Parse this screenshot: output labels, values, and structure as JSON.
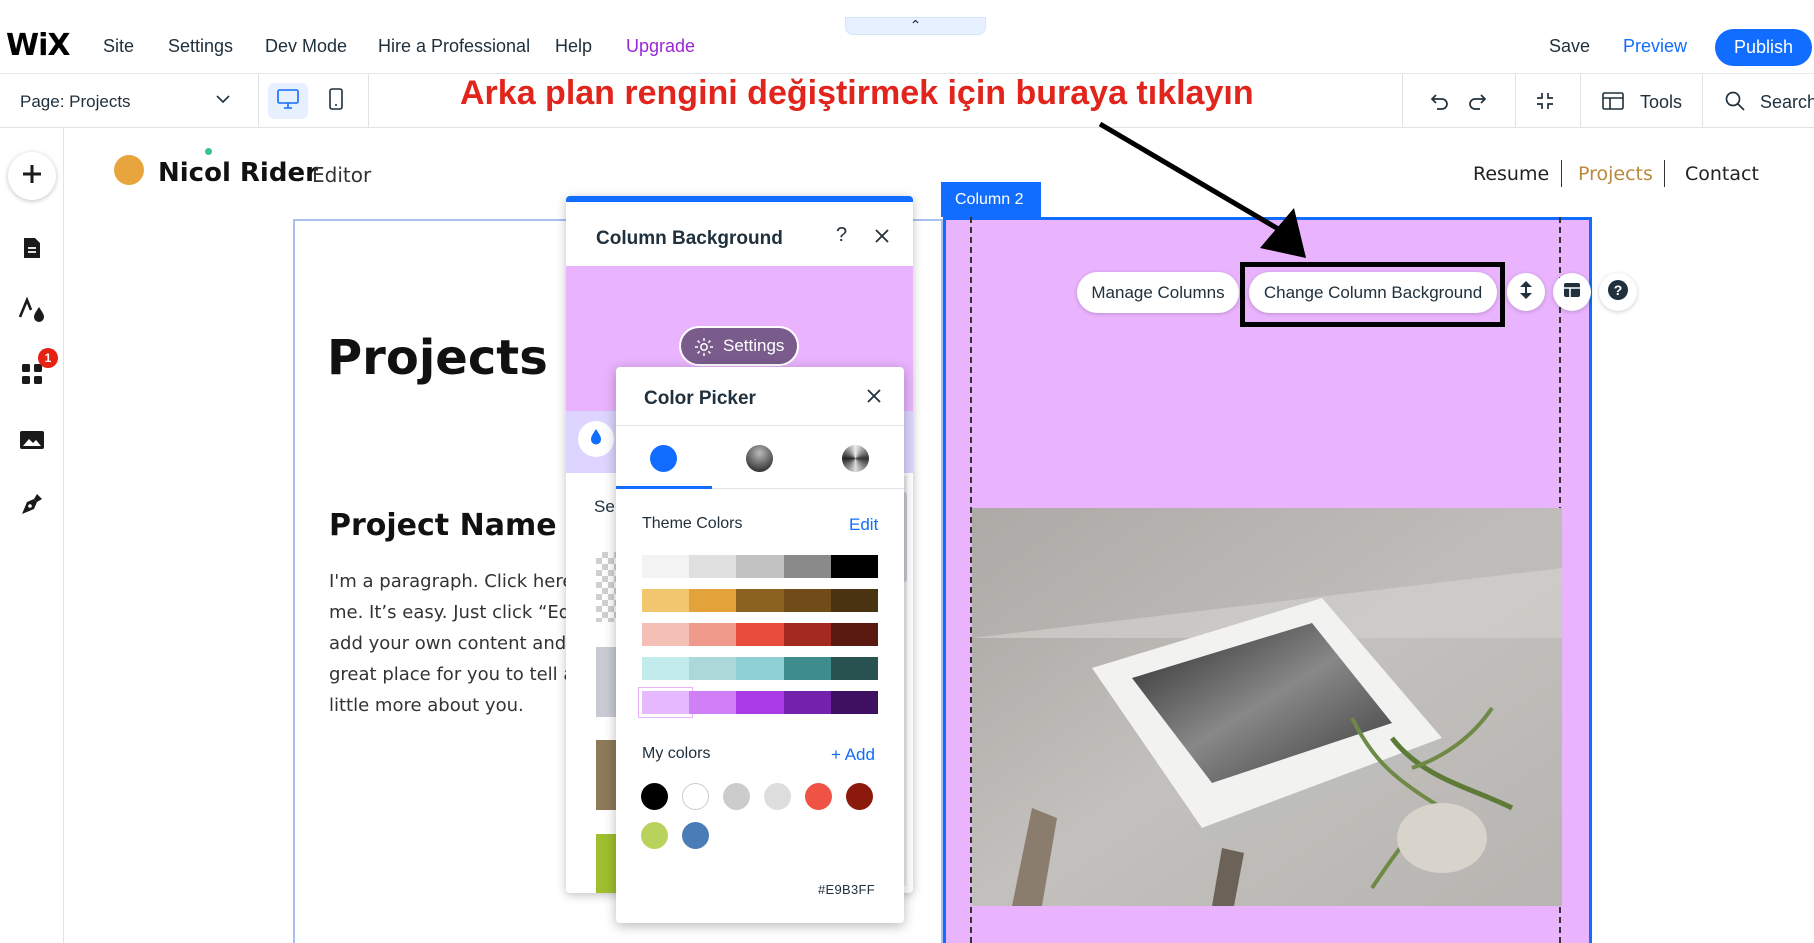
{
  "topbar": {
    "logo": "WiX",
    "menu": [
      "Site",
      "Settings",
      "Dev Mode",
      "Hire a Professional",
      "Help",
      "Upgrade"
    ],
    "handle_glyph": "⌃",
    "save": "Save",
    "preview": "Preview",
    "publish": "Publish"
  },
  "secondbar": {
    "page_select": "Page: Projects",
    "tools": "Tools",
    "search": "Search",
    "annotation": "Arka plan rengini değiştirmek için buraya tıklayın"
  },
  "leftbar": {
    "icons": [
      "add-icon",
      "pages-icon",
      "design-icon",
      "apps-icon",
      "media-icon",
      "pen-icon"
    ],
    "apps_badge": "1"
  },
  "site": {
    "name": "Nicol Rider",
    "role": "Editor",
    "nav": [
      "Resume",
      "Projects",
      "Contact"
    ],
    "heading": "Projects",
    "project_name": "Project Name 0",
    "paragraph": "I'm a paragraph. Click here t\nme. It’s easy. Just click “Edit\nadd your own content and m\ngreat place for you to tell a s\nlittle more about you."
  },
  "column2": {
    "label": "Column 2",
    "manage_columns": "Manage Columns",
    "change_background": "Change Column Background",
    "color": "#E9B3FF"
  },
  "panel": {
    "title": "Column Background",
    "help": "?",
    "settings": "Settings",
    "section_label_partial": "Se"
  },
  "picker": {
    "title": "Color Picker",
    "theme_colors_label": "Theme Colors",
    "edit": "Edit",
    "theme_rows": [
      [
        "#f3f3f3",
        "#e0e0e0",
        "#c2c2c2",
        "#8a8a8a",
        "#000000"
      ],
      [
        "#f2c66e",
        "#e4a23a",
        "#8c6220",
        "#6f4c18",
        "#4a3310"
      ],
      [
        "#f4bfb5",
        "#ef9a8a",
        "#e84c3a",
        "#a32a1f",
        "#5a1a12"
      ],
      [
        "#c2ecec",
        "#abd9d9",
        "#8fd0d4",
        "#3f8c8d",
        "#27524f"
      ],
      [
        "#e6b8ff",
        "#d17ff7",
        "#a93ae5",
        "#7421ad",
        "#3f0f62"
      ]
    ],
    "my_colors_label": "My colors",
    "add": "+ Add",
    "my_colors": [
      "#000000",
      "#ffffff",
      "#cccccc",
      "#dddddd",
      "#ef5346",
      "#8c1a0c",
      "#b9d25b",
      "#4a7db8"
    ],
    "hex": "#E9B3FF"
  }
}
